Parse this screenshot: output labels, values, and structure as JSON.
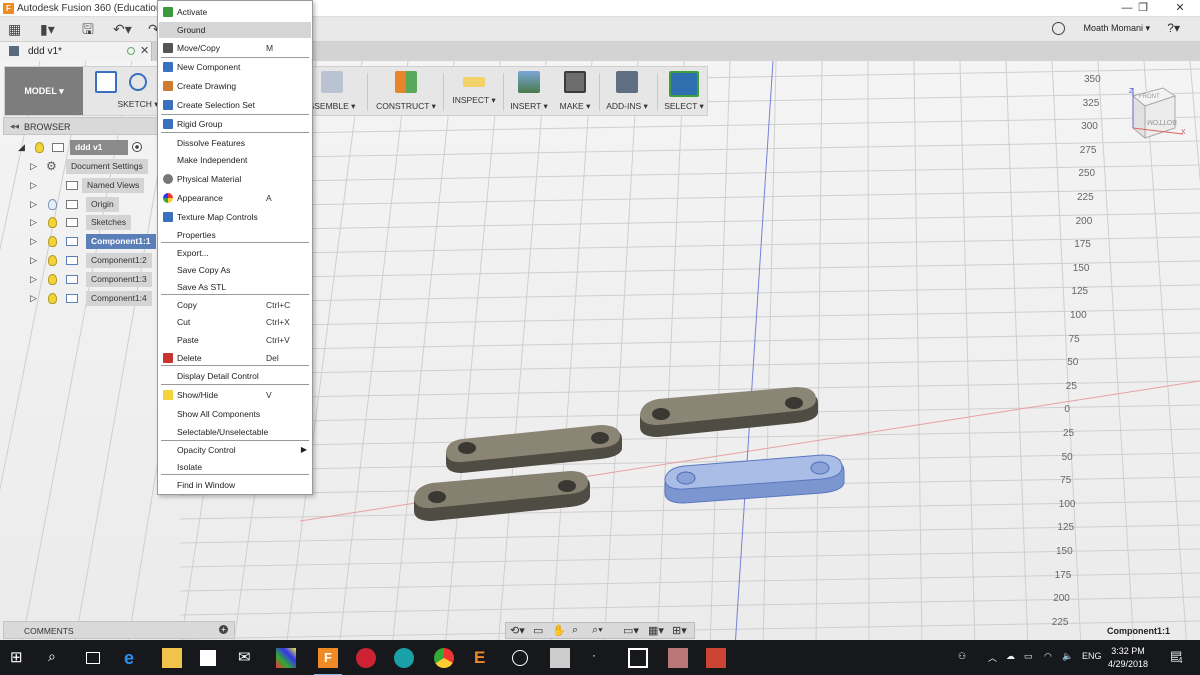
{
  "window": {
    "title": "Autodesk Fusion 360 (Education L",
    "minimize": "—",
    "maximize": "❐",
    "close": "✕"
  },
  "user": {
    "name": "Moath Momani ▾",
    "help": "?▾"
  },
  "document": {
    "tab_name": "ddd v1*"
  },
  "toolbar": {
    "mode": "MODEL ▾",
    "tools": [
      {
        "label": "SKETCH ▾"
      },
      {
        "label": "SSEMBLE ▾"
      },
      {
        "label": "CONSTRUCT ▾"
      },
      {
        "label": "INSPECT ▾"
      },
      {
        "label": "INSERT ▾"
      },
      {
        "label": "MAKE ▾"
      },
      {
        "label": "ADD-INS ▾"
      },
      {
        "label": "SELECT ▾"
      }
    ]
  },
  "browser": {
    "header": "BROWSER",
    "root": "ddd v1",
    "items": [
      {
        "label": "Document Settings"
      },
      {
        "label": "Named Views"
      },
      {
        "label": "Origin"
      },
      {
        "label": "Sketches"
      },
      {
        "label": "Component1:1"
      },
      {
        "label": "Component1:2"
      },
      {
        "label": "Component1:3"
      },
      {
        "label": "Component1:4"
      }
    ]
  },
  "context_menu": {
    "items": [
      {
        "label": "Activate",
        "shortcut": ""
      },
      {
        "label": "Ground",
        "shortcut": ""
      },
      {
        "label": "Move/Copy",
        "shortcut": "M"
      },
      {
        "label": "New Component",
        "shortcut": ""
      },
      {
        "label": "Create Drawing",
        "shortcut": ""
      },
      {
        "label": "Create Selection Set",
        "shortcut": ""
      },
      {
        "label": "Rigid Group",
        "shortcut": ""
      },
      {
        "label": "Dissolve Features",
        "shortcut": ""
      },
      {
        "label": "Make Independent",
        "shortcut": ""
      },
      {
        "label": "Physical Material",
        "shortcut": ""
      },
      {
        "label": "Appearance",
        "shortcut": "A"
      },
      {
        "label": "Texture Map Controls",
        "shortcut": ""
      },
      {
        "label": "Properties",
        "shortcut": ""
      },
      {
        "label": "Export...",
        "shortcut": ""
      },
      {
        "label": "Save Copy As",
        "shortcut": ""
      },
      {
        "label": "Save As STL",
        "shortcut": ""
      },
      {
        "label": "Copy",
        "shortcut": "Ctrl+C"
      },
      {
        "label": "Cut",
        "shortcut": "Ctrl+X"
      },
      {
        "label": "Paste",
        "shortcut": "Ctrl+V"
      },
      {
        "label": "Delete",
        "shortcut": "Del"
      },
      {
        "label": "Display Detail Control",
        "shortcut": ""
      },
      {
        "label": "Show/Hide",
        "shortcut": "V"
      },
      {
        "label": "Show All Components",
        "shortcut": ""
      },
      {
        "label": "Selectable/Unselectable",
        "shortcut": ""
      },
      {
        "label": "Opacity Control",
        "shortcut": ""
      },
      {
        "label": "Isolate",
        "shortcut": ""
      },
      {
        "label": "Find in Window",
        "shortcut": ""
      }
    ]
  },
  "comments": {
    "label": "COMMENTS"
  },
  "status": {
    "component": "Component1:1"
  },
  "viewcube": {
    "front": "FRONT",
    "bottom": "BOTTOM",
    "z": "Z",
    "x": "X"
  },
  "ruler_ticks": [
    "350",
    "325",
    "300",
    "275",
    "250",
    "225",
    "200",
    "175",
    "150",
    "125",
    "100",
    "75",
    "50",
    "25",
    "0",
    "25",
    "50",
    "75",
    "100",
    "125",
    "150",
    "175",
    "200",
    "225"
  ],
  "taskbar": {
    "time": "3:32 PM",
    "date": "4/29/2018",
    "lang": "ENG",
    "notifications": "4"
  },
  "colors": {
    "selected": "#5b7fb8",
    "part_dark": "#5d5a50",
    "part_selected": "#8fa8d8",
    "red_axis": "#e07070",
    "blue_axis": "#6a73d8"
  }
}
